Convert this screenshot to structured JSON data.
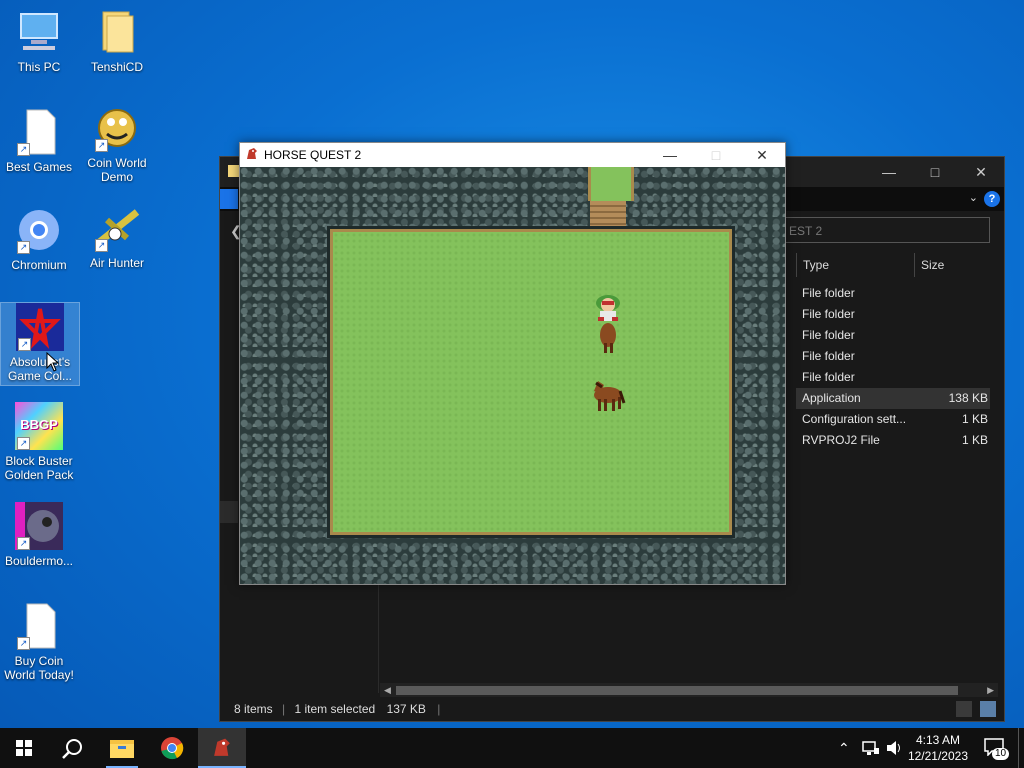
{
  "desktop": {
    "icons": [
      {
        "label": "This PC"
      },
      {
        "label": "TenshiCD"
      },
      {
        "label": "Best Games"
      },
      {
        "label": "Coin World Demo"
      },
      {
        "label": "Chromium"
      },
      {
        "label": "Air Hunter"
      },
      {
        "label": "Absolutist's Game Col..."
      },
      {
        "label": "Block Buster Golden Pack"
      },
      {
        "label": "Bouldermo..."
      },
      {
        "label": "Buy Coin World Today!"
      }
    ],
    "bbgp_text": "BBGP"
  },
  "explorer": {
    "address": "EST 2",
    "columns": {
      "type": "Type",
      "size": "Size"
    },
    "rows": [
      {
        "type": "File folder",
        "size": ""
      },
      {
        "type": "File folder",
        "size": ""
      },
      {
        "type": "File folder",
        "size": ""
      },
      {
        "type": "File folder",
        "size": ""
      },
      {
        "type": "File folder",
        "size": ""
      },
      {
        "type": "Application",
        "size": "138 KB",
        "selected": true
      },
      {
        "type": "Configuration sett...",
        "size": "1 KB"
      },
      {
        "type": "RVPROJ2 File",
        "size": "1 KB"
      }
    ],
    "status": {
      "items": "8 items",
      "selected": "1 item selected",
      "size": "137 KB"
    },
    "help": "?"
  },
  "game": {
    "title": "HORSE QUEST 2"
  },
  "taskbar": {
    "time": "4:13 AM",
    "date": "12/21/2023",
    "notifications": "10"
  },
  "colors": {
    "accent": "#0a6fd1",
    "game_grass": "#84c25c"
  }
}
